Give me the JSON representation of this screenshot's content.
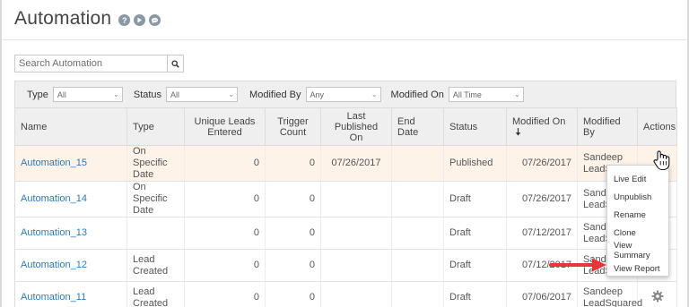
{
  "page": {
    "title": "Automation",
    "title_icons": [
      "help-icon",
      "play-icon",
      "chat-icon"
    ]
  },
  "search": {
    "placeholder": "Search Automation"
  },
  "filters": {
    "type_label": "Type",
    "type_value": "All",
    "status_label": "Status",
    "status_value": "All",
    "modified_by_label": "Modified By",
    "modified_by_value": "Any",
    "modified_on_label": "Modified On",
    "modified_on_value": "All Time"
  },
  "table": {
    "headers": {
      "name": "Name",
      "type": "Type",
      "unique_leads": "Unique Leads Entered",
      "trigger_count": "Trigger Count",
      "last_published": "Last Published On",
      "end_date": "End Date",
      "status": "Status",
      "modified_on": "Modified On",
      "modified_by": "Modified By",
      "actions": "Actions"
    },
    "rows": [
      {
        "name": "Automation_15",
        "type_line1": "On Specific",
        "type_line2": "Date",
        "unique": "0",
        "trigger": "0",
        "last_published": "07/26/2017",
        "end_date": "",
        "status": "Published",
        "modified_on": "07/26/2017",
        "mod_by_line1": "Sandeep",
        "mod_by_line2": "LeadSquared"
      },
      {
        "name": "Automation_14",
        "type_line1": "On Specific",
        "type_line2": "Date",
        "unique": "0",
        "trigger": "0",
        "last_published": "",
        "end_date": "",
        "status": "Draft",
        "modified_on": "07/26/2017",
        "mod_by_line1": "Sandeep",
        "mod_by_line2": "LeadSquared"
      },
      {
        "name": "Automation_13",
        "type_line1": "",
        "type_line2": "",
        "unique": "0",
        "trigger": "0",
        "last_published": "",
        "end_date": "",
        "status": "Draft",
        "modified_on": "07/12/2017",
        "mod_by_line1": "Sandeep",
        "mod_by_line2": "LeadSquared"
      },
      {
        "name": "Automation_12",
        "type_line1": "Lead",
        "type_line2": "Created",
        "unique": "0",
        "trigger": "0",
        "last_published": "",
        "end_date": "",
        "status": "Draft",
        "modified_on": "07/12/2017",
        "mod_by_line1": "Sandeep",
        "mod_by_line2": "LeadSquared"
      },
      {
        "name": "Automation_11",
        "type_line1": "Lead",
        "type_line2": "Created",
        "unique": "0",
        "trigger": "0",
        "last_published": "",
        "end_date": "",
        "status": "Draft",
        "modified_on": "07/06/2017",
        "mod_by_line1": "Sandeep",
        "mod_by_line2": "LeadSquared"
      }
    ]
  },
  "actions_menu": {
    "items": [
      "Live Edit",
      "Unpublish",
      "Rename",
      "Clone",
      "View Summary",
      "View Report"
    ]
  },
  "colors": {
    "link": "#2b7ac2",
    "highlight_row": "#fdf3e8",
    "annotation_arrow": "#e8353a"
  }
}
